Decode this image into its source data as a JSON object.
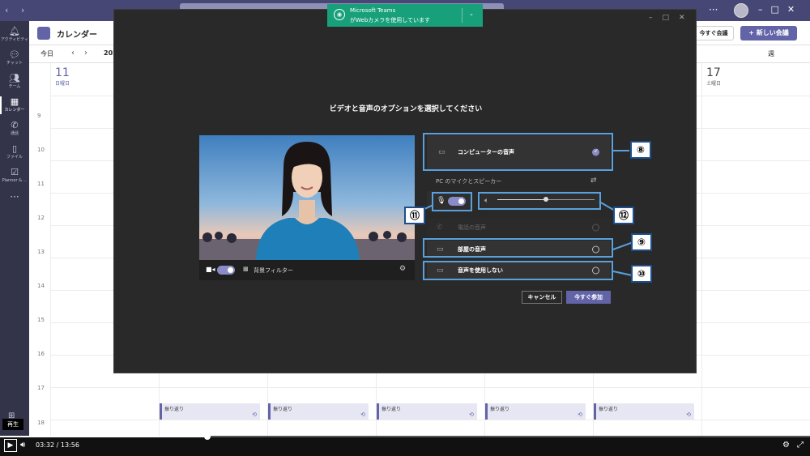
{
  "titlebar": {
    "dots": "···"
  },
  "rail": {
    "items": [
      {
        "label": "アクティビティ",
        "icon": "bell-icon"
      },
      {
        "label": "チャット",
        "icon": "chat-icon"
      },
      {
        "label": "チーム",
        "icon": "teams-icon"
      },
      {
        "label": "カレンダー",
        "icon": "calendar-icon"
      },
      {
        "label": "通話",
        "icon": "phone-icon"
      },
      {
        "label": "ファイル",
        "icon": "file-icon"
      },
      {
        "label": "Planner & ...",
        "icon": "planner-icon"
      }
    ],
    "more": "···"
  },
  "calendar": {
    "title": "カレンダー",
    "now_button": "今すぐ会議",
    "new_button": "+ 新しい会議",
    "today": "今日",
    "month": "202",
    "view": "週",
    "days": [
      {
        "num": "11",
        "name": "日曜日"
      },
      {
        "num": "17",
        "name": "土曜日"
      }
    ],
    "hours": [
      "9",
      "10",
      "11",
      "12",
      "13",
      "14",
      "15",
      "16",
      "17",
      "18"
    ],
    "event_label": "振り返り"
  },
  "toast": {
    "line1": "Microsoft Teams",
    "line2": "がWebカメラを使用しています"
  },
  "dialog": {
    "title": "ビデオと音声のオプションを選択してください",
    "background_filter": "背景フィルター",
    "options": {
      "computer_audio": "コンピューターの音声",
      "pc_mic_speaker": "PC のマイクとスピーカー",
      "phone_audio": "電話の音声",
      "room_audio": "部屋の音声",
      "no_audio": "音声を使用しない"
    },
    "cancel": "キャンセル",
    "join": "今すぐ参加"
  },
  "badges": {
    "b8": "⑧",
    "b9": "⑨",
    "b10": "⑩",
    "b11": "⑪",
    "b12": "⑫"
  },
  "player": {
    "tooltip": "再生",
    "current": "03:32",
    "total": "13:56",
    "separator": "/",
    "progress": 0.256
  },
  "colors": {
    "accent": "#6264a7",
    "highlight": "#5aa0dc",
    "toast": "#17a07a"
  }
}
